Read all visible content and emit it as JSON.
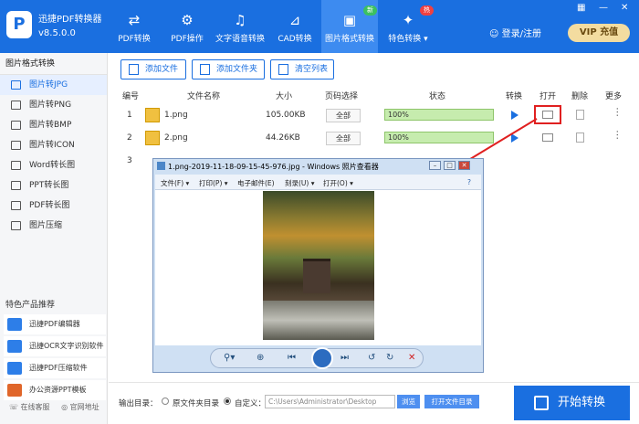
{
  "app": {
    "name": "迅捷PDF转换器",
    "version": "v8.5.0.0",
    "logo": "P"
  },
  "nav": [
    {
      "label": "PDF转换",
      "icon": "swap-icon"
    },
    {
      "label": "PDF操作",
      "icon": "gear-icon"
    },
    {
      "label": "文字语音转换",
      "icon": "audio-wave-icon"
    },
    {
      "label": "CAD转换",
      "icon": "cad-icon"
    },
    {
      "label": "图片格式转换",
      "icon": "image-icon",
      "badge": "新"
    },
    {
      "label": "特色转换 ▾",
      "icon": "gift-icon",
      "badge": "热"
    }
  ],
  "header": {
    "login": "登录/注册",
    "vip": "VIP 充值"
  },
  "sidebar": {
    "title": "图片格式转换",
    "items": [
      "图片转JPG",
      "图片转PNG",
      "图片转BMP",
      "图片转ICON",
      "Word转长图",
      "PPT转长图",
      "PDF转长图",
      "图片压缩"
    ],
    "featured_title": "特色产品推荐",
    "products": [
      "迅捷PDF编辑器",
      "迅捷OCR文字识别软件",
      "迅捷PDF压缩软件",
      "办公资源PPT模板"
    ],
    "bottom": [
      "在线客服",
      "官网地址"
    ]
  },
  "toolbar": {
    "add_file": "添加文件",
    "add_folder": "添加文件夹",
    "clear_list": "清空列表"
  },
  "table": {
    "headers": [
      "编号",
      "文件名称",
      "大小",
      "页码选择",
      "状态",
      "转换",
      "打开",
      "删除",
      "更多"
    ],
    "rows": [
      {
        "num": "1",
        "name": "1.png",
        "size": "105.00KB",
        "pages": "全部",
        "status": "100%"
      },
      {
        "num": "2",
        "name": "2.png",
        "size": "44.26KB",
        "pages": "全部",
        "status": "100%"
      },
      {
        "num": "3",
        "name": "",
        "size": "",
        "pages": "",
        "status": ""
      }
    ]
  },
  "viewer": {
    "title": "1.png-2019-11-18-09-15-45-976.jpg - Windows 照片查看器",
    "menu": [
      "文件(F) ▾",
      "打印(P) ▾",
      "电子邮件(E)",
      "刻录(U) ▾",
      "打开(O) ▾"
    ]
  },
  "bottom": {
    "output_label": "输出目录：",
    "opt_source": "原文件夹目录",
    "opt_custom": "自定义：",
    "path": "C:\\Users\\Administrator\\Desktop",
    "browse": "浏览",
    "open_folder": "打开文件目录",
    "start": "开始转换"
  }
}
